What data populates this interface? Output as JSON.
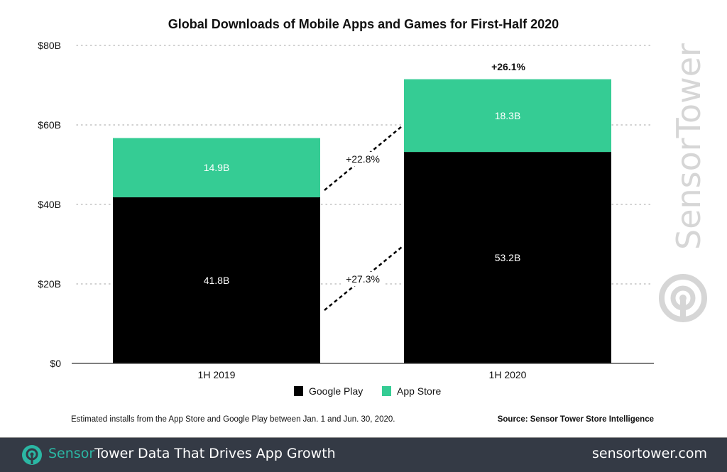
{
  "chart_data": {
    "type": "bar",
    "stacked": true,
    "title": "Global Downloads of Mobile Apps and Games for First-Half 2020",
    "xlabel": "",
    "ylabel": "",
    "categories": [
      "1H 2019",
      "1H 2020"
    ],
    "series": [
      {
        "name": "Google Play",
        "color": "#000000",
        "values": [
          41.8,
          53.2
        ],
        "labels": [
          "41.8B",
          "53.2B"
        ]
      },
      {
        "name": "App Store",
        "color": "#35CC94",
        "values": [
          14.9,
          18.3
        ],
        "labels": [
          "14.9B",
          "18.3B"
        ]
      }
    ],
    "ylim": [
      0,
      80
    ],
    "yticks": [
      0,
      20,
      40,
      60,
      80
    ],
    "ytick_labels": [
      "$0",
      "$20B",
      "$40B",
      "$60B",
      "$80B"
    ],
    "grid": "horizontal-dotted",
    "annotations": {
      "total_growth": "+26.1%",
      "app_store_growth": "+22.8%",
      "google_play_growth": "+27.3%"
    },
    "legend": {
      "position": "bottom-center",
      "entries": [
        "Google Play",
        "App Store"
      ]
    }
  },
  "notes": {
    "footnote": "Estimated installs from the App Store and Google Play between Jan. 1 and Jun. 30, 2020.",
    "source": "Source: Sensor Tower Store Intelligence"
  },
  "watermark": {
    "text": "SensorTower",
    "icon": "sensortower-logo-icon"
  },
  "footer": {
    "brand_part1": "Sensor",
    "brand_part2": "Tower",
    "tagline": "Data That Drives App Growth",
    "website": "sensortower.com",
    "accent": "#2bb7a4",
    "background": "#343a45"
  }
}
